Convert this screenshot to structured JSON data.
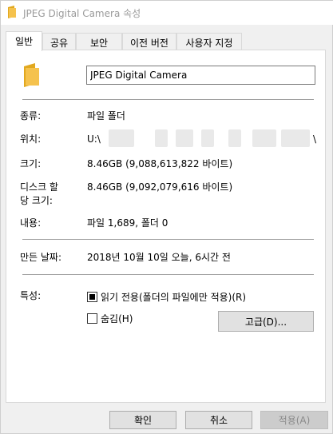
{
  "window": {
    "title": "JPEG Digital Camera 속성"
  },
  "tabs": [
    {
      "label": "일반"
    },
    {
      "label": "공유"
    },
    {
      "label": "보안"
    },
    {
      "label": "이전 버전"
    },
    {
      "label": "사용자 지정"
    }
  ],
  "general": {
    "folder_name": "JPEG Digital Camera",
    "type_label": "종류:",
    "type_value": "파일 폴더",
    "location_label": "위치:",
    "location_value": "U:\\",
    "location_end": "\\",
    "size_label": "크기:",
    "size_value": "8.46GB (9,088,613,822 바이트)",
    "disk_size_label_1": "디스크 할",
    "disk_size_label_2": "당 크기:",
    "disk_size_value": "8.46GB (9,092,079,616 바이트)",
    "contains_label": "내용:",
    "contains_value": "파일 1,689, 폴더 0",
    "created_label": "만든 날짜:",
    "created_value": "2018년 10월 10일 오늘, 6시간 전",
    "attributes_label": "특성:",
    "readonly_label": "읽기 전용(폴더의 파일에만 적용)(R)",
    "readonly_state": "indeterminate",
    "hidden_label": "숨김(H)",
    "hidden_state": "unchecked",
    "advanced_button": "고급(D)..."
  },
  "footer": {
    "ok": "확인",
    "cancel": "취소",
    "apply": "적용(A)"
  },
  "colors": {
    "folder": "#f5c24d",
    "folder_dark": "#e1a81f"
  }
}
